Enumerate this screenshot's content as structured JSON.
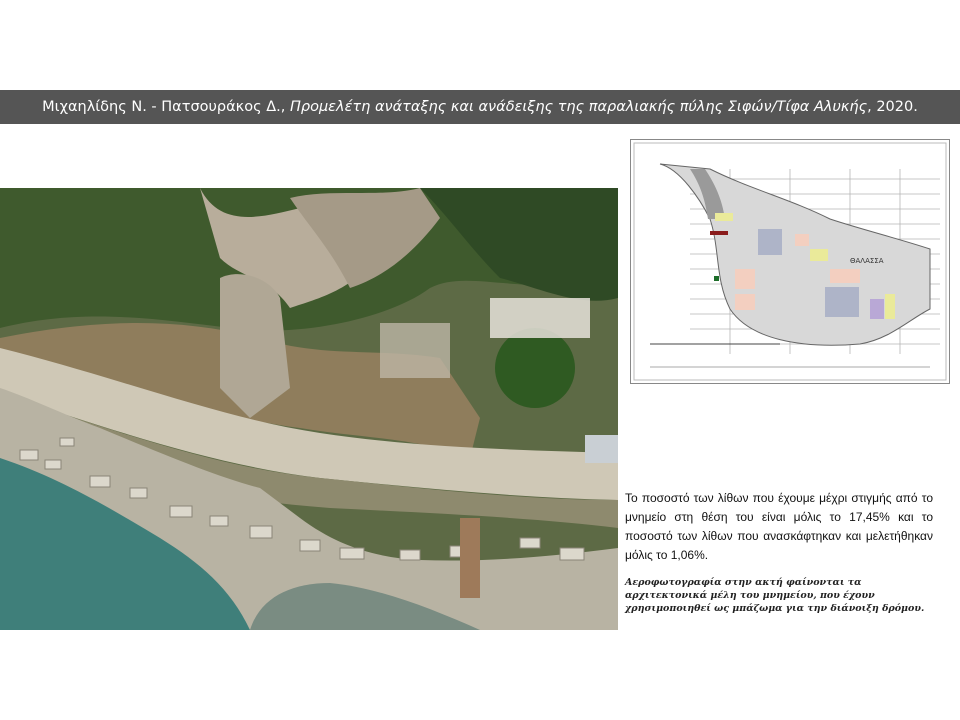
{
  "header": {
    "authors": "Μιχαηλίδης Ν. - Πατσουράκος Δ.,",
    "work_title": "Προμελέτη ανάταξης και ανάδειξης της παραλιακής πύλης Σιφών/Τίφα Αλυκής",
    "year": ", 2020."
  },
  "stat_text": "Το ποσοστό των λίθων που έχουμε μέχρι στιγμής από το μνημείο στη θέση του είναι μόλις το 17,45% και το ποσοστό των λίθων που ανασκάφτηκαν και μελετήθηκαν μόλις το 1,06%.",
  "caption": "Αεροφωτογραφία στην ακτή φαίνονται τα αρχιτεκτονικά μέλη του μνημείου, που έχουν χρησιμοποιηθεί ως μπάζωμα για την διάνοιξη δρόμου.",
  "plan_label": "ΘΑΛΑΣΣΑ"
}
